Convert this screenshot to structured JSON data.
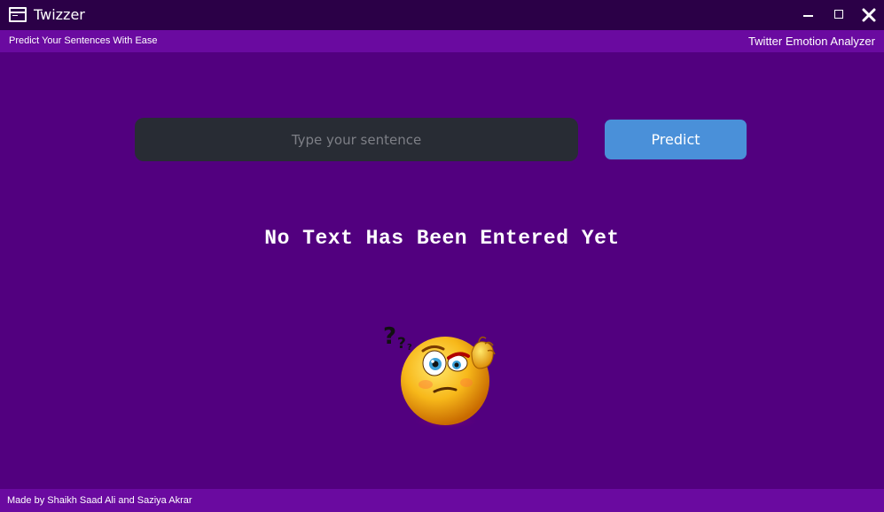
{
  "window": {
    "title": "Twizzer",
    "icon": "terminal-window-icon"
  },
  "header": {
    "tagline": "Predict Your Sentences With Ease",
    "app_name": "Twitter Emotion Analyzer"
  },
  "input": {
    "value": "",
    "placeholder": "Type your sentence"
  },
  "predict_button": {
    "label": "Predict"
  },
  "result": {
    "message": "No Text Has Been Entered Yet",
    "emoji": "confused-thinking-emoji"
  },
  "footer": {
    "credits": "Made by Shaikh Saad Ali and Saziya Akrar"
  },
  "colors": {
    "titlebar": "#2b0047",
    "background": "#52007f",
    "bars": "#6a0aa0",
    "input_bg": "#282c34",
    "button_bg": "#4a90d9"
  }
}
